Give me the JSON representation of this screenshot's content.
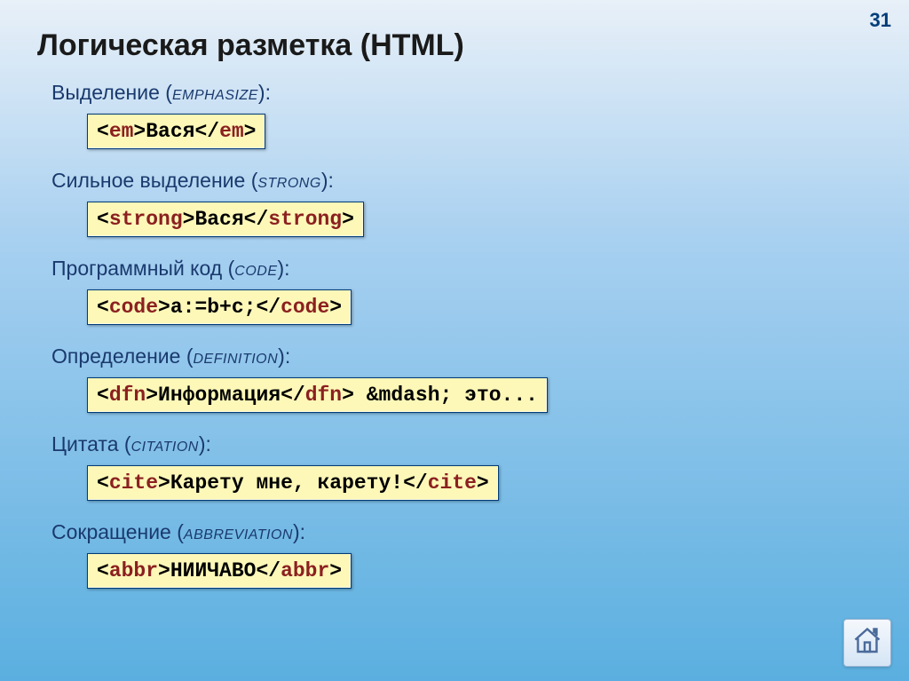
{
  "page_number": "31",
  "title": "Логическая разметка (HTML)",
  "sections": [
    {
      "label_ru": "Выделение",
      "label_en": "emphasize",
      "tag": "em",
      "content": "Вася",
      "extra": ""
    },
    {
      "label_ru": "Сильное выделение",
      "label_en": "strong",
      "tag": "strong",
      "content": "Вася",
      "extra": ""
    },
    {
      "label_ru": "Программный код",
      "label_en": "code",
      "tag": "code",
      "content": "a:=b+c;",
      "extra": ""
    },
    {
      "label_ru": "Определение",
      "label_en": "definition",
      "tag": "dfn",
      "content": "Информация",
      "extra": " &mdash; это..."
    },
    {
      "label_ru": "Цитата",
      "label_en": "citation",
      "tag": "cite",
      "content": "Карету мне, карету!",
      "extra": ""
    },
    {
      "label_ru": "Сокращение",
      "label_en": "abbreviation",
      "tag": "abbr",
      "content": "НИИЧАВО",
      "extra": ""
    }
  ]
}
